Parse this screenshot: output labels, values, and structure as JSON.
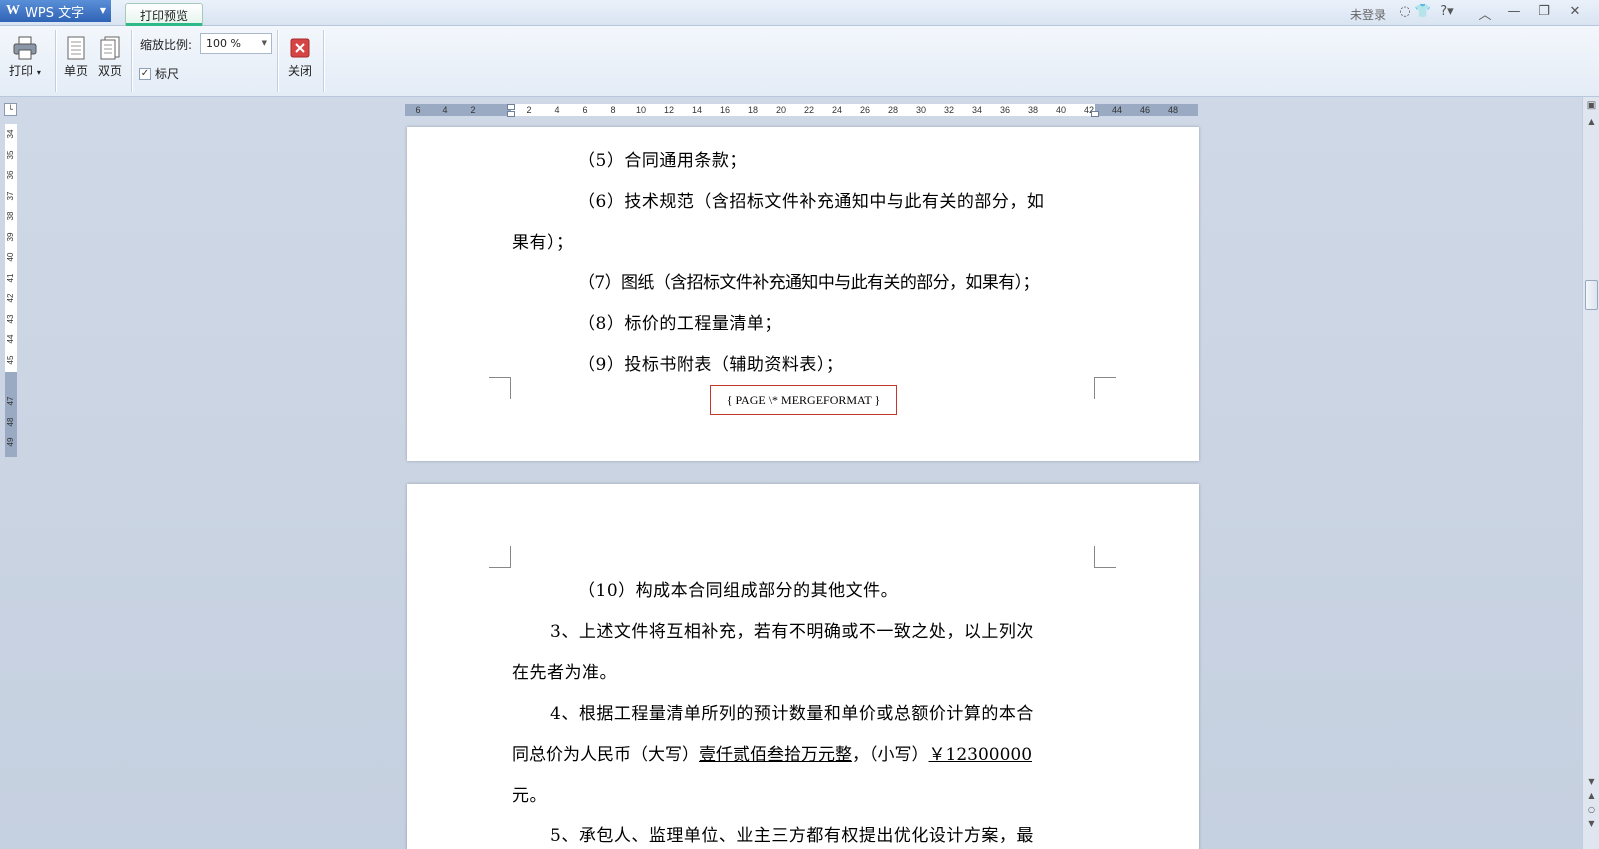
{
  "titlebar": {
    "app_name": "WPS 文字",
    "tab_label": "打印预览",
    "login_text": "未登录",
    "icons": [
      "chat-icon",
      "shirt-icon",
      "help-icon",
      "collapse-icon",
      "minimize-icon",
      "restore-icon",
      "close-icon"
    ]
  },
  "toolbar": {
    "print_label": "打印",
    "single_page_label": "单页",
    "double_page_label": "双页",
    "zoom_label": "缩放比例:",
    "zoom_value": "100 %",
    "ruler_label": "标尺",
    "ruler_checked": true,
    "close_label": "关闭"
  },
  "hruler": {
    "ticks": [
      "6",
      "4",
      "2",
      "2",
      "4",
      "6",
      "8",
      "10",
      "12",
      "14",
      "16",
      "18",
      "20",
      "22",
      "24",
      "26",
      "28",
      "30",
      "32",
      "34",
      "36",
      "38",
      "40",
      "42",
      "44",
      "46",
      "48"
    ]
  },
  "vruler": {
    "ticks": [
      "34",
      "35",
      "36",
      "37",
      "38",
      "39",
      "40",
      "41",
      "42",
      "43",
      "44",
      "45",
      "47",
      "48",
      "49"
    ]
  },
  "page1": {
    "lines": [
      "（5）合同通用条款；",
      "（6）技术规范（含招标文件补充通知中与此有关的部分，如",
      "果有）；",
      "（7）图纸（含招标文件补充通知中与此有关的部分，如果有）；",
      "（8）标价的工程量清单；",
      "（9）投标书附表（辅助资料表）；"
    ],
    "field_code": "{ PAGE   \\* MERGEFORMAT }"
  },
  "page2": {
    "lines": [
      "（10）构成本合同组成部分的其他文件。",
      "3、上述文件将互相补充，若有不明确或不一致之处，以上列次",
      "在先者为准。",
      "元。",
      "5、承包人、监理单位、业主三方都有权提出优化设计方案，最"
    ],
    "line4a_pre": "4、根据工程量清单所列的预计数量和单价或总额价计算的本合",
    "line4b_pre": "同总价为人民币（大写）",
    "line4b_amount_words": "壹仟贰佰叁拾万元整",
    "line4b_mid": "，（小写）",
    "line4b_amount_figures": "￥12300000"
  }
}
